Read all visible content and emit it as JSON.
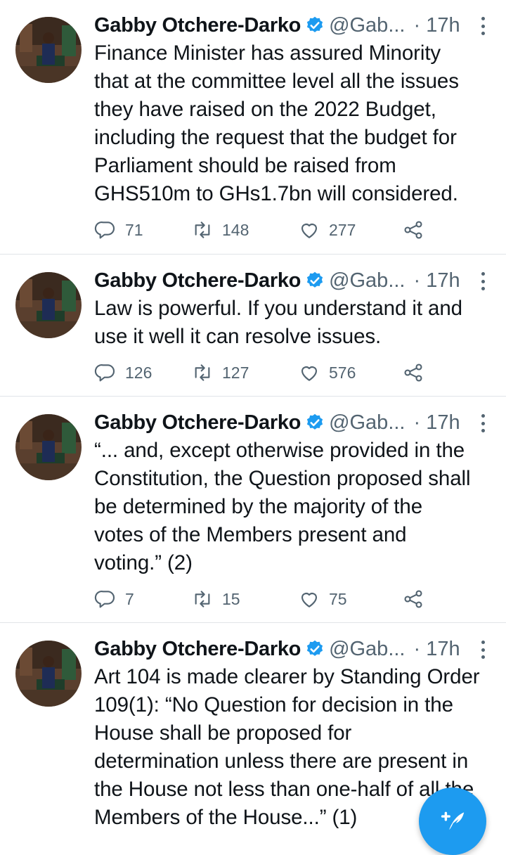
{
  "accent_color": "#1d9bf0",
  "tweets": [
    {
      "name": "Gabby Otchere-Darko",
      "handle": "@Gab...",
      "time": "· 17h",
      "text": "Finance Minister has assured Minority\nthat at the committee level all the issues\nthey have raised on the 2022 Budget,\nincluding the request that the budget for\nParliament should be raised from\nGHS510m to GHs1.7bn will considered.",
      "replies": "71",
      "retweets": "148",
      "likes": "277"
    },
    {
      "name": "Gabby Otchere-Darko",
      "handle": "@Gab...",
      "time": "· 17h",
      "text": "Law is powerful. If you understand it and\nuse it well it can resolve issues.",
      "replies": "126",
      "retweets": "127",
      "likes": "576"
    },
    {
      "name": "Gabby Otchere-Darko",
      "handle": "@Gab...",
      "time": "· 17h",
      "text": "“... and, except otherwise provided in the\nConstitution, the Question proposed shall\nbe determined by the majority of the\nvotes of the Members present and\nvoting.” (2)",
      "replies": "7",
      "retweets": "15",
      "likes": "75"
    },
    {
      "name": "Gabby Otchere-Darko",
      "handle": "@Gab...",
      "time": "· 17h",
      "text": "Art 104 is made clearer by Standing Order\n109(1): “No Question for decision in the\nHouse shall be proposed for\ndetermination unless there are present in\nthe House not less than one-half of all the\nMembers of the House...” (1)"
    }
  ],
  "compose_button_icon": "compose-feather-plus-icon"
}
